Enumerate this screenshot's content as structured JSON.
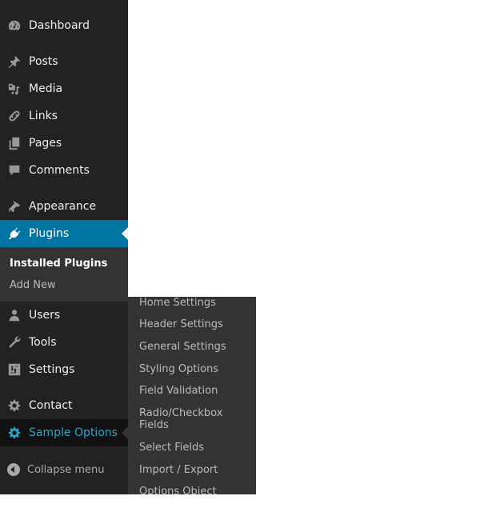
{
  "menu": {
    "items": [
      {
        "label": "Dashboard",
        "icon": "dashboard-icon"
      },
      {
        "label": "Posts",
        "icon": "pin-icon"
      },
      {
        "label": "Media",
        "icon": "media-icon"
      },
      {
        "label": "Links",
        "icon": "link-icon"
      },
      {
        "label": "Pages",
        "icon": "pages-icon"
      },
      {
        "label": "Comments",
        "icon": "comment-icon"
      },
      {
        "label": "Appearance",
        "icon": "paintbrush-icon"
      },
      {
        "label": "Plugins",
        "icon": "plugin-icon",
        "state": "current"
      },
      {
        "label": "Users",
        "icon": "user-icon"
      },
      {
        "label": "Tools",
        "icon": "wrench-icon"
      },
      {
        "label": "Settings",
        "icon": "settings-icon"
      },
      {
        "label": "Contact",
        "icon": "gear-icon"
      },
      {
        "label": "Sample Options",
        "icon": "gear-icon",
        "state": "hover"
      }
    ],
    "plugins_submenu": [
      {
        "label": "Installed Plugins",
        "current": true
      },
      {
        "label": "Add New"
      }
    ],
    "collapse_label": "Collapse menu"
  },
  "flyout": {
    "items": [
      "Home Settings",
      "Header Settings",
      "General Settings",
      "Styling Options",
      "Field Validation",
      "Radio/Checkbox Fields",
      "Select Fields",
      "Import / Export",
      "Options Object"
    ]
  },
  "colors": {
    "menu_bg": "#222222",
    "submenu_bg": "#333333",
    "current_bg": "#0074a2",
    "hover_text": "#2ea2cc",
    "text": "#eeeeee"
  }
}
